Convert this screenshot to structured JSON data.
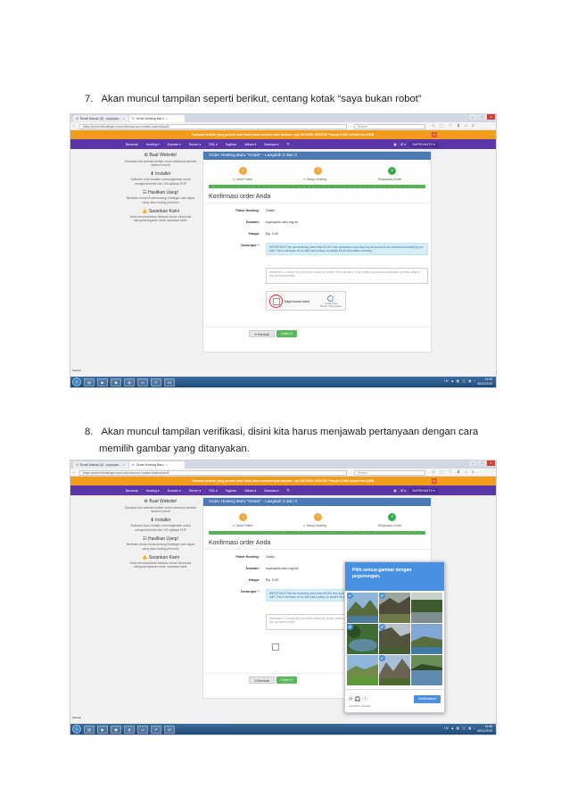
{
  "step7": {
    "number": "7.",
    "text": "Akan muncul tampilan seperti berikut, centang kotak “saya bukan robot”"
  },
  "step8": {
    "number": "8.",
    "line1": "Akan muncul tampilan verifikasi, disini kita harus menjawab pertanyaan dengan cara",
    "line2": "memilih gambar yang ditanyakan."
  },
  "browser": {
    "tab1": "Email Masuk (0) - supriyan...",
    "tab2": "Order Hosting Baru",
    "url": "https://panel.idhostinger.com/order/account-create-wizard/plan/8",
    "search_placeholder": "Search",
    "nav_icons": "☆ ⬚ ♡ ⬇ ⌂ ≡"
  },
  "promo": {
    "text": "Tawaran terbaik yang pernah ada! Kami akan memberikan domain .xyz SECARA GRATIS! *Hanya 0,99$ setelah itu 3,99$.",
    "close": "×"
  },
  "sitenav": {
    "items": [
      "Beranda",
      "Hosting ▾",
      "Domain ▾",
      "Server ▾",
      "SSL ▾",
      "Tagihan",
      "Afiliasi ▾",
      "Bantuan ▾",
      "🔍"
    ],
    "lang": "ID ▾",
    "account": "SUPRIYANTO ▾"
  },
  "sidebar": [
    {
      "title": "⚙ Buat Website!",
      "text": "Gunakan tool website builder untuk membuat website dalam 5 menit"
    },
    {
      "title": "⬇ Installer",
      "text": "Software Auto Installer memungkinkan untuk menginstal lebih dari 100 aplikasi PHP"
    },
    {
      "title": "☷ Hasilkan Uang!",
      "text": "Berikahu teman Anda tentang Hostinger dan dapat uang atau hosting premium"
    },
    {
      "title": "👍 Sarankan Kami",
      "text": "Kami membutuhkan bantuan Anda! Jika Anda menyukai layanan kami, sarankan kami."
    }
  ],
  "order": {
    "header": "Order Hosting Baru \"Gratis\" - Langkah 3 dari 3",
    "steps": [
      {
        "n": "1",
        "label": "✔ Ubah Paket",
        "color": "#f0a93c"
      },
      {
        "n": "2",
        "label": "✔ Setup Hosting",
        "color": "#f0a93c"
      },
      {
        "n": "3",
        "label": "Ringkasan Order",
        "color": "#3cab4f"
      }
    ],
    "title": "Konfirmasi order Anda",
    "fields": [
      {
        "label": "Paket Hosting:",
        "value": "Gratis"
      },
      {
        "label": "Domain:",
        "value": "supriyanto.idm.org.es"
      },
      {
        "label": "Harga:",
        "value": "Rp. 0,00"
      },
      {
        "label": "Deskripsi: *",
        "value": ""
      }
    ],
    "notice": "IMPORTANT! We are receiving more than 50,000 new activations each day and all accounts are reviewed manually by our staff. This is because of our anti fraud policy, so please fill all information correctly.",
    "textarea_placeholder": "Describe in 2 words why you have chosen to create a free account? It will make your account activation process faster if you do that correctly.",
    "captcha_label": "Saya bukan robot",
    "captcha_brand": "reCAPTCHA",
    "captcha_terms": "Privasi - Persyaratan",
    "back_button": "⟲ Kembali",
    "order_button": "Order ⊡"
  },
  "status": "Selesai",
  "taskbar": {
    "tray_text": "IN ▲ ◧ ◫ ◨ ♪",
    "time": "13:46",
    "date": "08/11/2015"
  },
  "taskbar2": {
    "time": "13:48",
    "date": "08/11/2015"
  },
  "verify": {
    "heading": "Pilih semua gambar dengan pegunungan.",
    "icons": "⟳ 🎧 ⓘ",
    "link": "Laporkan masalah",
    "button": "Verifikasikan"
  },
  "colors": {
    "orange": "#f39b1d",
    "purple": "#5a36a8",
    "blue": "#4a7ab5",
    "green": "#5cb85c",
    "recaptcha": "#4a90e2"
  }
}
